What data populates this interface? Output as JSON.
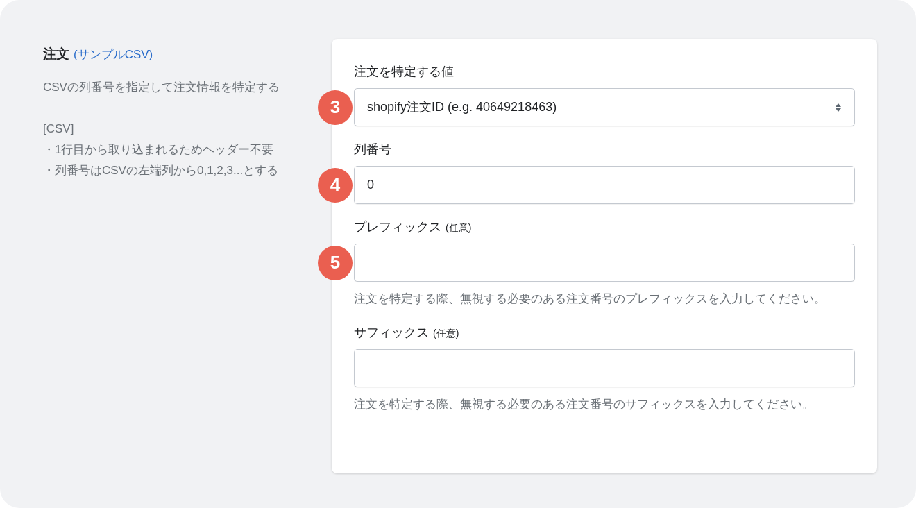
{
  "section": {
    "title": "注文",
    "link": "(サンプルCSV)",
    "description": [
      "CSVの列番号を指定して注文情報を特定する",
      "[CSV]",
      "・1行目から取り込まれるためヘッダー不要",
      "・列番号はCSVの左端列から0,1,2,3...とする"
    ]
  },
  "fields": [
    {
      "kind": "select",
      "label": "注文を特定する値",
      "value": "shopify注文ID (e.g. 40649218463)",
      "badge": "3"
    },
    {
      "kind": "input",
      "label": "列番号",
      "value": "0",
      "badge": "4"
    },
    {
      "kind": "input",
      "label": "プレフィックス",
      "optional": "(任意)",
      "badge": "5",
      "help": "注文を特定する際、無視する必要のある注文番号のプレフィックスを入力してください。"
    },
    {
      "kind": "input",
      "label": "サフィックス",
      "optional": "(任意)",
      "help": "注文を特定する際、無視する必要のある注文番号のサフィックスを入力してください。"
    }
  ]
}
